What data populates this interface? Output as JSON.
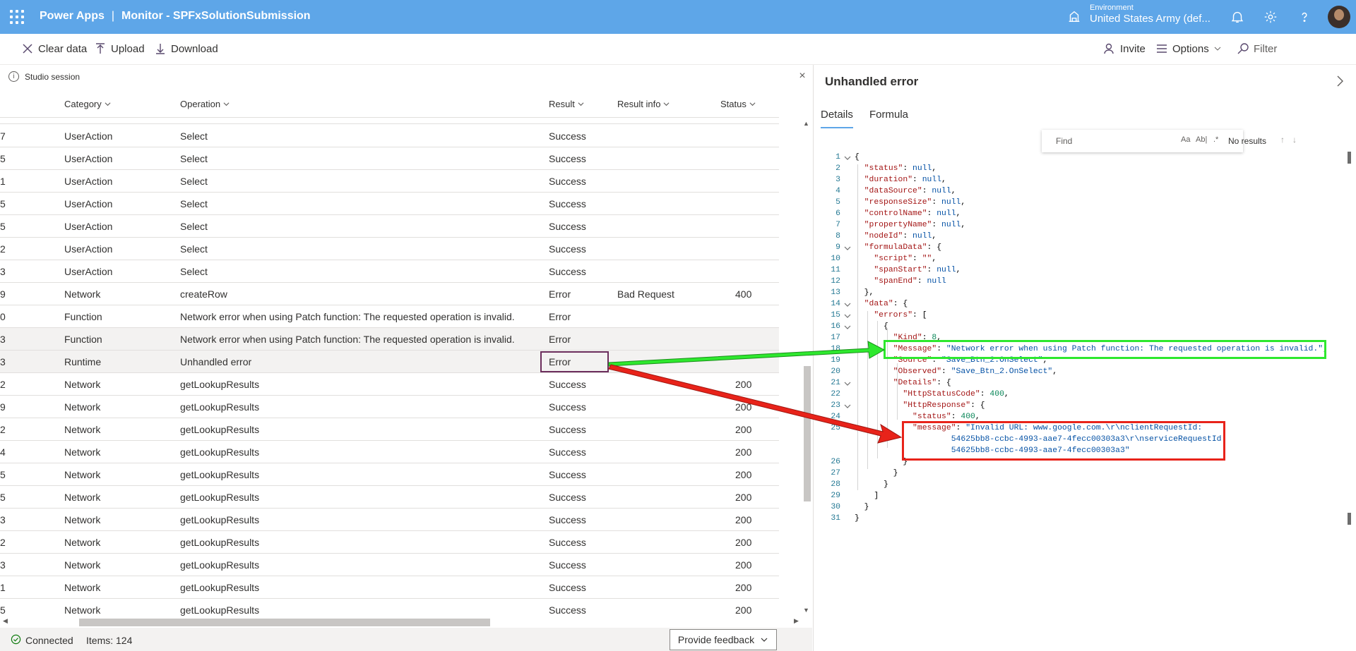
{
  "header": {
    "app_name": "Power Apps",
    "separator": "|",
    "page_title": "Monitor - SPFxSolutionSubmission",
    "environment_label": "Environment",
    "environment_value": "United States Army (def..."
  },
  "toolbar": {
    "clear_label": "Clear data",
    "upload_label": "Upload",
    "download_label": "Download",
    "invite_label": "Invite",
    "options_label": "Options",
    "filter_label": "Filter"
  },
  "session": {
    "label": "Studio session"
  },
  "grid": {
    "columns": [
      "Category",
      "Operation",
      "Result",
      "Result info",
      "Status"
    ],
    "rows": [
      {
        "idx": "7",
        "category": "UserAction",
        "operation": "Select",
        "result": "Success",
        "result_info": "",
        "status": ""
      },
      {
        "idx": "5",
        "category": "UserAction",
        "operation": "Select",
        "result": "Success",
        "result_info": "",
        "status": ""
      },
      {
        "idx": "1",
        "category": "UserAction",
        "operation": "Select",
        "result": "Success",
        "result_info": "",
        "status": ""
      },
      {
        "idx": "5",
        "category": "UserAction",
        "operation": "Select",
        "result": "Success",
        "result_info": "",
        "status": ""
      },
      {
        "idx": "5",
        "category": "UserAction",
        "operation": "Select",
        "result": "Success",
        "result_info": "",
        "status": ""
      },
      {
        "idx": "2",
        "category": "UserAction",
        "operation": "Select",
        "result": "Success",
        "result_info": "",
        "status": ""
      },
      {
        "idx": "3",
        "category": "UserAction",
        "operation": "Select",
        "result": "Success",
        "result_info": "",
        "status": ""
      },
      {
        "idx": "9",
        "category": "Network",
        "operation": "createRow",
        "result": "Error",
        "result_info": "Bad Request",
        "status": "400"
      },
      {
        "idx": "0",
        "category": "Function",
        "operation": "Network error when using Patch function: The requested operation is invalid.",
        "result": "Error",
        "result_info": "",
        "status": ""
      },
      {
        "idx": "3",
        "category": "Function",
        "operation": "Network error when using Patch function: The requested operation is invalid.",
        "result": "Error",
        "result_info": "",
        "status": ""
      },
      {
        "idx": "3",
        "category": "Runtime",
        "operation": "Unhandled error",
        "result": "Error",
        "result_info": "",
        "status": ""
      },
      {
        "idx": "2",
        "category": "Network",
        "operation": "getLookupResults",
        "result": "Success",
        "result_info": "",
        "status": "200"
      },
      {
        "idx": "9",
        "category": "Network",
        "operation": "getLookupResults",
        "result": "Success",
        "result_info": "",
        "status": "200"
      },
      {
        "idx": "2",
        "category": "Network",
        "operation": "getLookupResults",
        "result": "Success",
        "result_info": "",
        "status": "200"
      },
      {
        "idx": "4",
        "category": "Network",
        "operation": "getLookupResults",
        "result": "Success",
        "result_info": "",
        "status": "200"
      },
      {
        "idx": "5",
        "category": "Network",
        "operation": "getLookupResults",
        "result": "Success",
        "result_info": "",
        "status": "200"
      },
      {
        "idx": "5",
        "category": "Network",
        "operation": "getLookupResults",
        "result": "Success",
        "result_info": "",
        "status": "200"
      },
      {
        "idx": "3",
        "category": "Network",
        "operation": "getLookupResults",
        "result": "Success",
        "result_info": "",
        "status": "200"
      },
      {
        "idx": "2",
        "category": "Network",
        "operation": "getLookupResults",
        "result": "Success",
        "result_info": "",
        "status": "200"
      },
      {
        "idx": "3",
        "category": "Network",
        "operation": "getLookupResults",
        "result": "Success",
        "result_info": "",
        "status": "200"
      },
      {
        "idx": "1",
        "category": "Network",
        "operation": "getLookupResults",
        "result": "Success",
        "result_info": "",
        "status": "200"
      },
      {
        "idx": "5",
        "category": "Network",
        "operation": "getLookupResults",
        "result": "Success",
        "result_info": "",
        "status": "200"
      }
    ]
  },
  "statusbar": {
    "connection": "Connected",
    "items": "Items: 124",
    "feedback_label": "Provide feedback"
  },
  "details": {
    "title": "Unhandled error",
    "tabs": [
      "Details",
      "Formula"
    ],
    "find": {
      "placeholder": "Find",
      "case_label": "Aa",
      "word_label": "Ab|",
      "regex_label": ".*",
      "result_text": "No results"
    },
    "code_lines": [
      [
        [
          "p",
          "{"
        ]
      ],
      [
        [
          "k",
          "  \"status\""
        ],
        [
          "p",
          ": "
        ],
        [
          "v",
          "null"
        ],
        [
          "p",
          ","
        ]
      ],
      [
        [
          "k",
          "  \"duration\""
        ],
        [
          "p",
          ": "
        ],
        [
          "v",
          "null"
        ],
        [
          "p",
          ","
        ]
      ],
      [
        [
          "k",
          "  \"dataSource\""
        ],
        [
          "p",
          ": "
        ],
        [
          "v",
          "null"
        ],
        [
          "p",
          ","
        ]
      ],
      [
        [
          "k",
          "  \"responseSize\""
        ],
        [
          "p",
          ": "
        ],
        [
          "v",
          "null"
        ],
        [
          "p",
          ","
        ]
      ],
      [
        [
          "k",
          "  \"controlName\""
        ],
        [
          "p",
          ": "
        ],
        [
          "v",
          "null"
        ],
        [
          "p",
          ","
        ]
      ],
      [
        [
          "k",
          "  \"propertyName\""
        ],
        [
          "p",
          ": "
        ],
        [
          "v",
          "null"
        ],
        [
          "p",
          ","
        ]
      ],
      [
        [
          "k",
          "  \"nodeId\""
        ],
        [
          "p",
          ": "
        ],
        [
          "v",
          "null"
        ],
        [
          "p",
          ","
        ]
      ],
      [
        [
          "k",
          "  \"formulaData\""
        ],
        [
          "p",
          ": {"
        ]
      ],
      [
        [
          "k",
          "    \"script\""
        ],
        [
          "p",
          ": "
        ],
        [
          "k",
          "\"\""
        ],
        [
          "p",
          ","
        ]
      ],
      [
        [
          "k",
          "    \"spanStart\""
        ],
        [
          "p",
          ": "
        ],
        [
          "v",
          "null"
        ],
        [
          "p",
          ","
        ]
      ],
      [
        [
          "k",
          "    \"spanEnd\""
        ],
        [
          "p",
          ": "
        ],
        [
          "v",
          "null"
        ]
      ],
      [
        [
          "p",
          "  },"
        ]
      ],
      [
        [
          "k",
          "  \"data\""
        ],
        [
          "p",
          ": {"
        ]
      ],
      [
        [
          "k",
          "    \"errors\""
        ],
        [
          "p",
          ": ["
        ]
      ],
      [
        [
          "p",
          "      {"
        ]
      ],
      [
        [
          "k",
          "        \"Kind\""
        ],
        [
          "p",
          ": "
        ],
        [
          "n",
          "8"
        ],
        [
          "p",
          ","
        ]
      ],
      [
        [
          "k",
          "        \"Message\""
        ],
        [
          "p",
          ": "
        ],
        [
          "v",
          "\"Network error when using Patch function: The requested operation is invalid.\""
        ],
        [
          "p",
          ","
        ]
      ],
      [
        [
          "k",
          "        \"Source\""
        ],
        [
          "p",
          ": "
        ],
        [
          "v",
          "\"Save_Btn_2.OnSelect\""
        ],
        [
          "p",
          ","
        ]
      ],
      [
        [
          "k",
          "        \"Observed\""
        ],
        [
          "p",
          ": "
        ],
        [
          "v",
          "\"Save_Btn_2.OnSelect\""
        ],
        [
          "p",
          ","
        ]
      ],
      [
        [
          "k",
          "        \"Details\""
        ],
        [
          "p",
          ": {"
        ]
      ],
      [
        [
          "k",
          "          \"HttpStatusCode\""
        ],
        [
          "p",
          ": "
        ],
        [
          "n",
          "400"
        ],
        [
          "p",
          ","
        ]
      ],
      [
        [
          "k",
          "          \"HttpResponse\""
        ],
        [
          "p",
          ": {"
        ]
      ],
      [
        [
          "k",
          "            \"status\""
        ],
        [
          "p",
          ": "
        ],
        [
          "n",
          "400"
        ],
        [
          "p",
          ","
        ]
      ],
      [
        [
          "k",
          "            \"message\""
        ],
        [
          "p",
          ": "
        ],
        [
          "v",
          "\"Invalid URL: www.google.com.\\r\\nclientRequestId:"
        ]
      ],
      [
        [
          "v",
          "                    54625bb8-ccbc-4993-aae7-4fecc00303a3\\r\\nserviceRequestId:"
        ]
      ],
      [
        [
          "v",
          "                    54625bb8-ccbc-4993-aae7-4fecc00303a3\""
        ]
      ],
      [
        [
          "p",
          "          }"
        ]
      ],
      [
        [
          "p",
          "        }"
        ]
      ],
      [
        [
          "p",
          "      }"
        ]
      ],
      [
        [
          "p",
          "    ]"
        ]
      ],
      [
        [
          "p",
          "  }"
        ]
      ],
      [
        [
          "p",
          "}"
        ]
      ]
    ],
    "line_numbers": [
      "1",
      "2",
      "3",
      "4",
      "5",
      "6",
      "7",
      "8",
      "9",
      "10",
      "11",
      "12",
      "13",
      "14",
      "15",
      "16",
      "17",
      "18",
      "19",
      "20",
      "21",
      "22",
      "23",
      "24",
      "25",
      "",
      "",
      "26",
      "27",
      "28",
      "29",
      "30",
      "31"
    ]
  },
  "colors": {
    "header_bg": "#5ea6e8",
    "error_selection": "#6b2d5c",
    "annotation_green": "#2ee82e",
    "annotation_red": "#e8231a"
  }
}
